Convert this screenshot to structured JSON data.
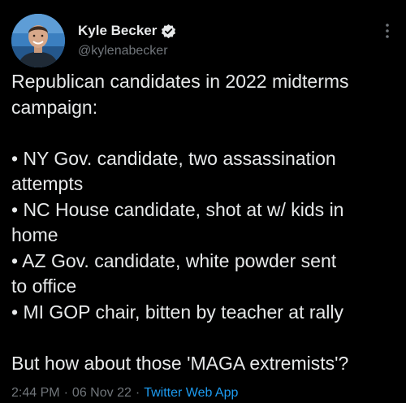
{
  "author": {
    "display_name": "Kyle Becker",
    "handle": "@kylenabecker",
    "verified": true
  },
  "tweet": {
    "lines": [
      "Republican candidates in 2022 midterms",
      "campaign:",
      "",
      "• NY Gov. candidate, two assassination",
      "attempts",
      "• NC House candidate, shot at w/ kids in",
      "home",
      "• AZ Gov. candidate, white powder sent",
      "to office",
      "• MI GOP chair, bitten by teacher at rally",
      "",
      "But how about those 'MAGA extremists'?"
    ]
  },
  "meta": {
    "time": "2:44 PM",
    "separator": "·",
    "date": "06 Nov 22",
    "source": "Twitter Web App"
  },
  "icons": {
    "verified": "verified-badge-icon",
    "more": "more-options-icon"
  },
  "colors": {
    "background": "#000000",
    "primary_text": "#e7e9ea",
    "secondary_text": "#71767b",
    "accent": "#1d9bf0"
  }
}
